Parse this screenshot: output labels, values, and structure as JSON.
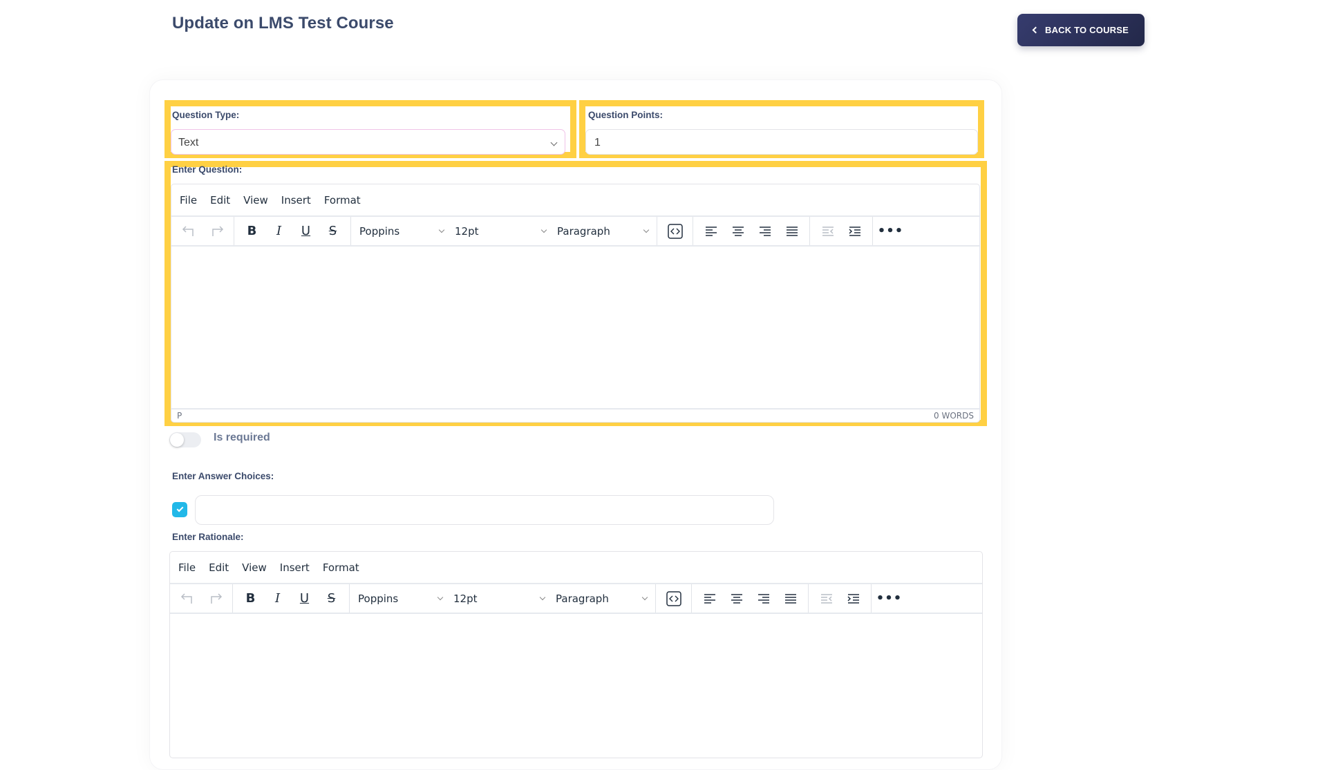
{
  "header": {
    "title": "Update on LMS Test Course",
    "back_button_label": "BACK TO COURSE"
  },
  "form": {
    "question_type": {
      "label": "Question Type:",
      "value": "Text"
    },
    "question_points": {
      "label": "Question Points:",
      "value": "1"
    },
    "enter_question": {
      "label": "Enter Question:",
      "editor": {
        "menu": [
          "File",
          "Edit",
          "View",
          "Insert",
          "Format"
        ],
        "font_family": "Poppins",
        "font_size": "12pt",
        "block_format": "Paragraph",
        "status_path": "P",
        "word_count": "0 WORDS"
      }
    },
    "is_required": {
      "label": "Is required",
      "checked": false
    },
    "answer_choices": {
      "label": "Enter Answer Choices:",
      "items": [
        {
          "checked": true,
          "value": ""
        }
      ]
    },
    "rationale": {
      "label": "Enter Rationale:",
      "editor": {
        "menu": [
          "File",
          "Edit",
          "View",
          "Insert",
          "Format"
        ],
        "font_family": "Poppins",
        "font_size": "12pt",
        "block_format": "Paragraph"
      }
    }
  },
  "colors": {
    "highlight": "#ffd043",
    "primary_button": "#2c3160",
    "checkbox": "#22b8e8",
    "title": "#3b4a6b"
  }
}
